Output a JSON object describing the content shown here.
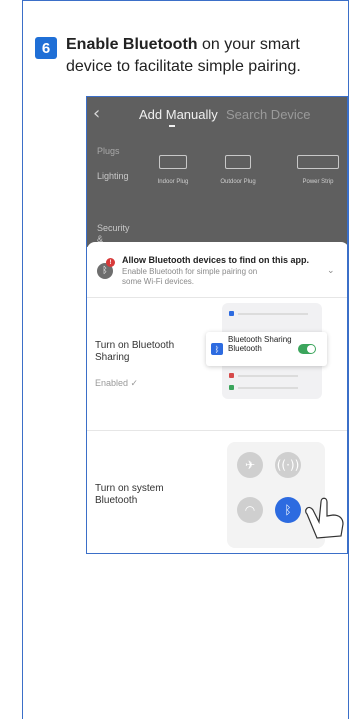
{
  "step": {
    "number": "6",
    "bold_text": "Enable Bluetooth",
    "text": " on your smart device to facilitate simple pairing."
  },
  "app": {
    "back_icon": "chevron-left-icon",
    "tabs": [
      "Add Manually",
      "Search Device"
    ],
    "categories": [
      "Plugs",
      "Lighting",
      "Security & Cameras"
    ],
    "devices": [
      "Indoor Plug",
      "Outdoor Plug",
      "Power Strip"
    ]
  },
  "sheet": {
    "badge": "!",
    "title": "Allow Bluetooth devices to find on this app.",
    "subtitle": "Enable Bluetooth for simple pairing on some Wi-Fi devices.",
    "step1_label": "Turn on Bluetooth Sharing",
    "step1_status": "Enabled ✓",
    "step2_label": "Turn on system Bluetooth",
    "share_card_text": "Bluetooth Sharing Bluetooth",
    "toggle_on": true
  },
  "colors": {
    "accent": "#1f6fd6",
    "toggle": "#3ba55c",
    "overlay": "#5f5f5f"
  }
}
